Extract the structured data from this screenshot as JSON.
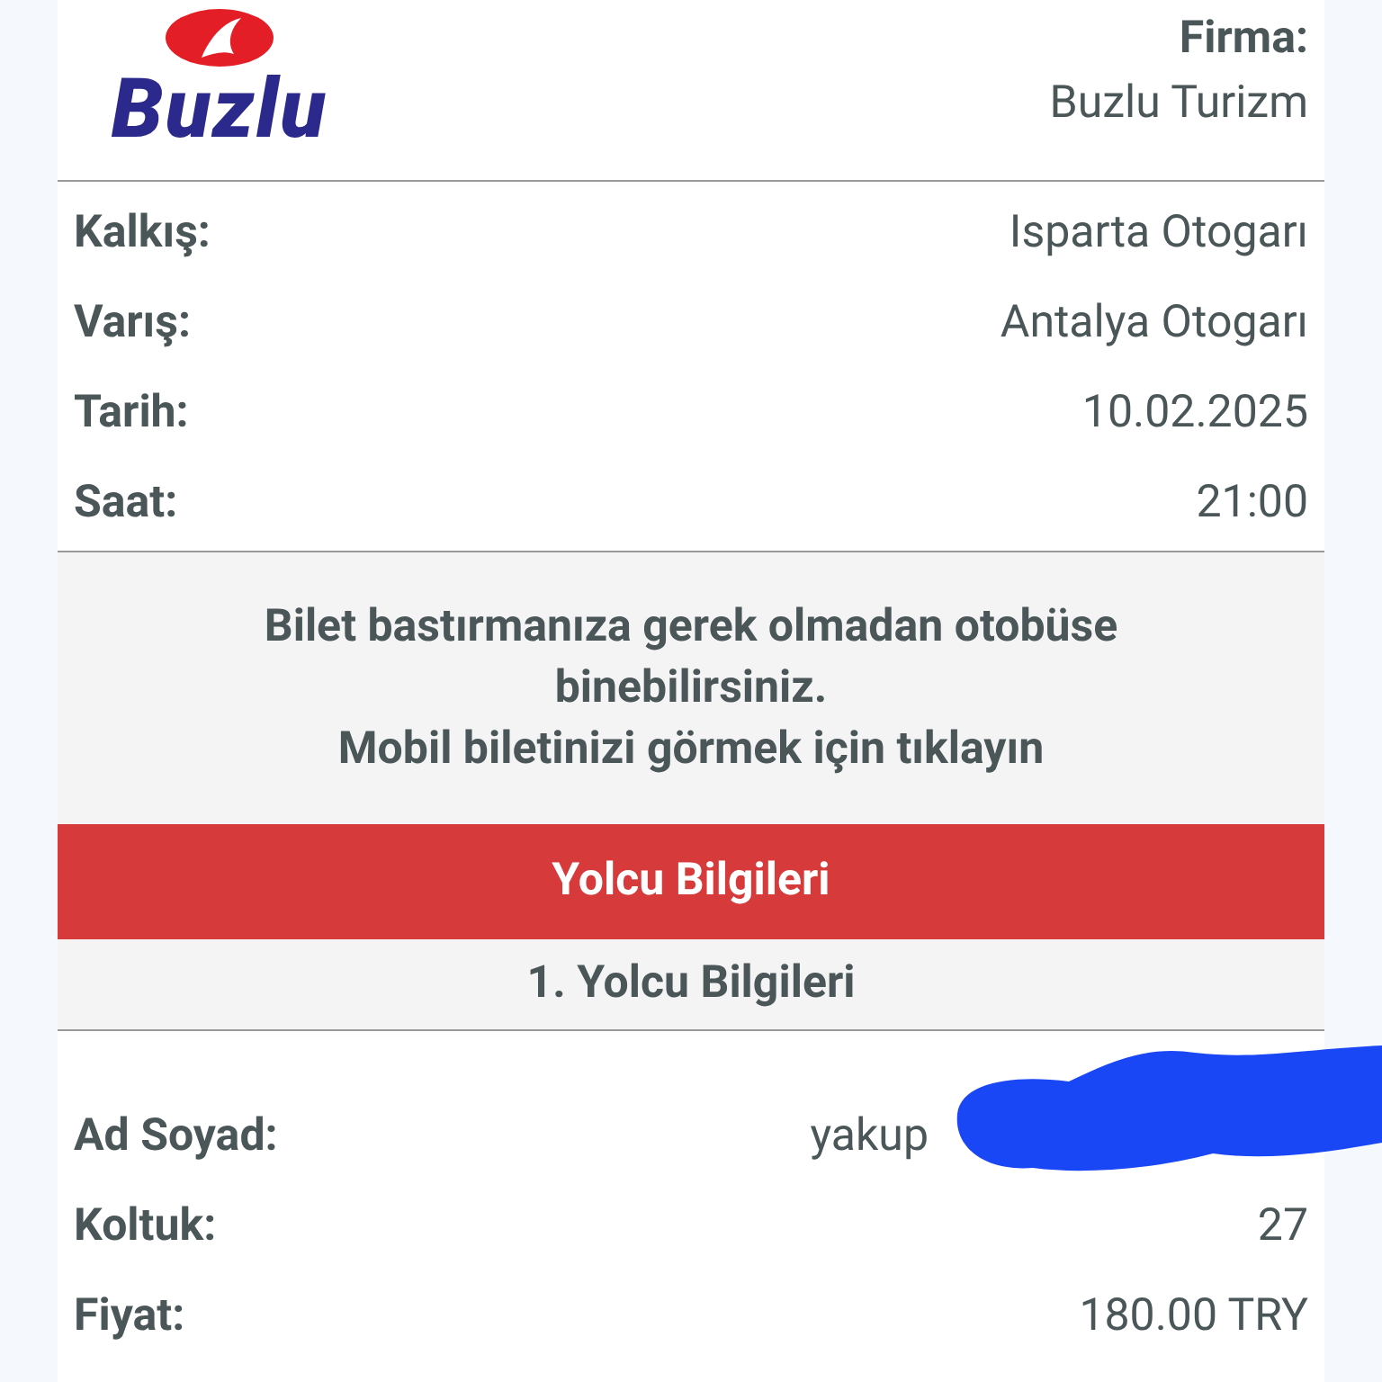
{
  "logo": {
    "text": "Buzlu"
  },
  "company": {
    "label": "Firma:",
    "value": "Buzlu Turizm"
  },
  "trip": [
    {
      "label": "Kalkış:",
      "value": "Isparta Otogarı"
    },
    {
      "label": "Varış:",
      "value": "Antalya Otogarı"
    },
    {
      "label": "Tarih:",
      "value": "10.02.2025"
    },
    {
      "label": "Saat:",
      "value": "21:00"
    }
  ],
  "notice": {
    "lines": [
      "Bilet bastırmanıza gerek olmadan otobüse binebilirsiniz.",
      "Mobil biletinizi görmek için tıklayın"
    ]
  },
  "section_title": "Yolcu Bilgileri",
  "passenger_title": "1. Yolcu Bilgileri",
  "passenger": [
    {
      "label": "Ad Soyad:",
      "value": "yakup",
      "redacted": true
    },
    {
      "label": "Koltuk:",
      "value": "27",
      "redacted": false
    },
    {
      "label": "Fiyat:",
      "value": "180.00 TRY",
      "redacted": false
    }
  ]
}
